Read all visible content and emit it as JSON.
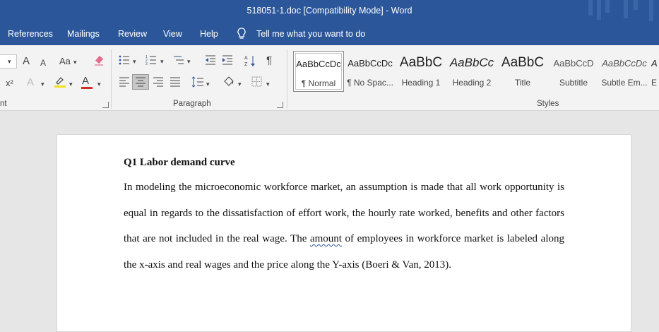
{
  "window": {
    "title": "518051-1.doc [Compatibility Mode]  -  Word"
  },
  "menu": {
    "tabs": [
      "References",
      "Mailings",
      "Review",
      "View",
      "Help"
    ],
    "tell_me": "Tell me what you want to do",
    "tell_me_icon": "lightbulb-icon"
  },
  "ribbon": {
    "font_group_label": "nt",
    "paragraph_group_label": "Paragraph",
    "styles_group_label": "Styles",
    "font_buttons": {
      "grow_font": "A",
      "shrink_font": "A",
      "change_case": "Aa",
      "superscript": "x²",
      "font_color_letter": "A",
      "text_effects_letter": "A"
    },
    "highlight_color": "#f5e11b",
    "font_color": "#d22b2b",
    "styles": [
      {
        "sample": "AaBbCcDc",
        "name": "¶ Normal",
        "selected": true
      },
      {
        "sample": "AaBbCcDc",
        "name": "¶ No Spac..."
      },
      {
        "sample": "AaBbC",
        "name": "Heading 1"
      },
      {
        "sample": "AaBbCc",
        "name": "Heading 2"
      },
      {
        "sample": "AaBbC",
        "name": "Title"
      },
      {
        "sample": "AaBbCcD",
        "name": "Subtitle"
      },
      {
        "sample": "AaBbCcDc",
        "name": "Subtle Em..."
      },
      {
        "sample": "A",
        "name": "E"
      }
    ]
  },
  "document": {
    "heading": "Q1 Labor demand curve",
    "paragraph_before": "In modeling the microeconomic workforce market, an assumption is made that all work opportunity is equal in regards to the dissatisfaction of effort work, the hourly rate worked, benefits and other factors that are not included in the real wage. The ",
    "flagged_word": "amount",
    "paragraph_after": " of employees in workforce market is labeled along the x-axis and real wages and the price along the Y-axis (Boeri & Van, 2013)."
  },
  "colors": {
    "title_bar": "#2b579a",
    "ribbon_bg": "#f3f3f3",
    "canvas_bg": "#e6e6e6"
  }
}
